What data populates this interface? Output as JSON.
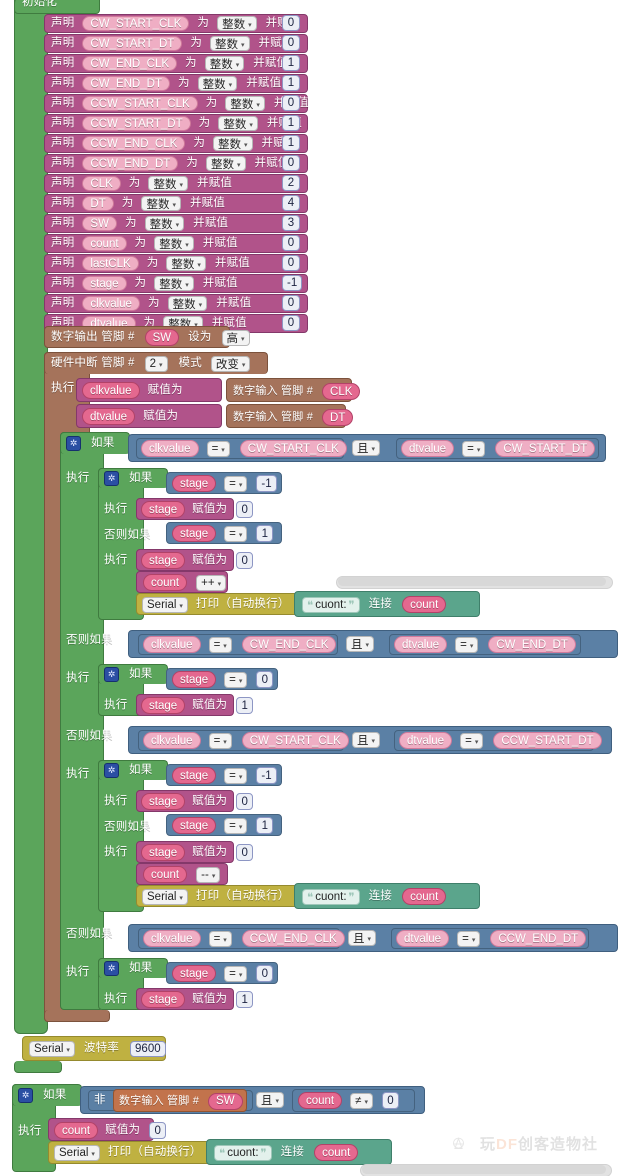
{
  "app": {
    "kind": "blockly-visual-programming-canvas",
    "language": "zh-CN"
  },
  "labels": {
    "init": "初始化",
    "declare": "声明",
    "as": "为",
    "and_assign": "并赋值",
    "type_int": "整数",
    "digital_write": "数字输出 管脚 #",
    "set_to": "设为",
    "high": "高",
    "attach_interrupt": "硬件中断 管脚 #",
    "mode": "模式",
    "mode_change": "改变",
    "do": "执行",
    "assign_to": "赋值为",
    "digital_read": "数字输入 管脚 #",
    "if": "如果",
    "elseif": "否则如果",
    "and": "且",
    "not": "非",
    "serial": "Serial",
    "print_ln": "打印（自动换行）",
    "join": "连接",
    "baud": "波特率",
    "gear": "✲",
    "caret": "▾",
    "eq": "=",
    "neq": "≠",
    "inc": "++",
    "dec": "--",
    "quote_open": "❝",
    "quote_close": "❞"
  },
  "declarations": [
    {
      "name": "CW_START_CLK",
      "type": "整数",
      "value": "0"
    },
    {
      "name": "CW_START_DT",
      "type": "整数",
      "value": "0"
    },
    {
      "name": "CW_END_CLK",
      "type": "整数",
      "value": "1"
    },
    {
      "name": "CW_END_DT",
      "type": "整数",
      "value": "1"
    },
    {
      "name": "CCW_START_CLK",
      "type": "整数",
      "value": "0"
    },
    {
      "name": "CCW_START_DT",
      "type": "整数",
      "value": "1"
    },
    {
      "name": "CCW_END_CLK",
      "type": "整数",
      "value": "1"
    },
    {
      "name": "CCW_END_DT",
      "type": "整数",
      "value": "0"
    },
    {
      "name": "CLK",
      "type": "整数",
      "value": "2"
    },
    {
      "name": "DT",
      "type": "整数",
      "value": "4"
    },
    {
      "name": "SW",
      "type": "整数",
      "value": "3"
    },
    {
      "name": "count",
      "type": "整数",
      "value": "0"
    },
    {
      "name": "lastCLK",
      "type": "整数",
      "value": "0"
    },
    {
      "name": "stage",
      "type": "整数",
      "value": "-1"
    },
    {
      "name": "clkvalue",
      "type": "整数",
      "value": "0"
    },
    {
      "name": "dtvalue",
      "type": "整数",
      "value": "0"
    }
  ],
  "digital_output": {
    "pin": "SW",
    "state": "高"
  },
  "interrupt": {
    "pin": "2",
    "mode": "改变"
  },
  "reads": [
    {
      "target": "clkvalue",
      "pin": "CLK"
    },
    {
      "target": "dtvalue",
      "pin": "DT"
    }
  ],
  "conditions": {
    "c1_left_var": "clkvalue",
    "c1_left_val": "CW_START_CLK",
    "c1_right_var": "dtvalue",
    "c1_right_val": "CW_START_DT",
    "c2_left_var": "clkvalue",
    "c2_left_val": "CW_END_CLK",
    "c2_right_var": "dtvalue",
    "c2_right_val": "CW_END_DT",
    "c3_left_var": "clkvalue",
    "c3_left_val": "CW_START_CLK",
    "c3_right_var": "dtvalue",
    "c3_right_val": "CCW_START_DT",
    "c4_left_var": "clkvalue",
    "c4_left_val": "CCW_END_CLK",
    "c4_right_var": "dtvalue",
    "c4_right_val": "CCW_END_DT"
  },
  "stage_tests": {
    "s_neg1": "-1",
    "s_zero": "0",
    "s_one": "1"
  },
  "vars": {
    "stage": "stage",
    "count": "count",
    "clkvalue": "clkvalue",
    "dtvalue": "dtvalue"
  },
  "serial_print": {
    "text": "cuont:",
    "value": "count"
  },
  "serial_begin": {
    "port": "Serial",
    "baud": "9600"
  },
  "bottom_if": {
    "not_pin": "SW",
    "count_var": "count",
    "count_cmp": "≠",
    "count_val": "0",
    "assign_var": "count",
    "assign_val": "0"
  },
  "watermark": {
    "prefix": "玩",
    "brand": "DF",
    "suffix": "创客造物社"
  },
  "colors": {
    "hat_green": "#5ba55b",
    "declare_pink": "#b1538a",
    "io_brown": "#a5735b",
    "logic_blue": "#5b80a5",
    "control_green": "#5ba55b",
    "math_indigo": "#7986cb",
    "var_pink": "#e4688f",
    "serial_olive": "#bfb141",
    "text_teal": "#5ba58c"
  }
}
